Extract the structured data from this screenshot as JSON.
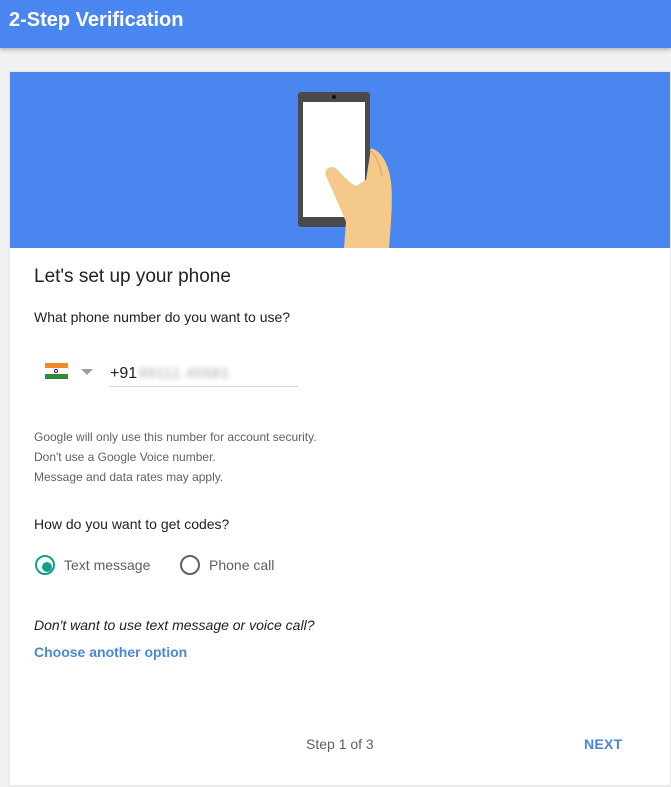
{
  "window": {
    "title": "2-Step Verification"
  },
  "hero": {
    "illustration": "phone-in-hand",
    "background_color": "#4a86f0"
  },
  "setup": {
    "heading": "Let's set up your phone",
    "phone_question": "What phone number do you want to use?",
    "country": {
      "flag_icon": "india-flag-icon",
      "dropdown_icon": "triangle-down-icon"
    },
    "phone": {
      "country_code": "+91",
      "number_masked": "99111 45581"
    },
    "help_lines": [
      "Google will only use this number for account security.",
      "Don't use a Google Voice number.",
      "Message and data rates may apply."
    ],
    "codes_question": "How do you want to get codes?",
    "options": [
      {
        "label": "Text message",
        "selected": true
      },
      {
        "label": "Phone call",
        "selected": false
      }
    ],
    "alternative_question": "Don't want to use text message or voice call?",
    "alternative_link": "Choose another option"
  },
  "footer": {
    "step_text": "Step 1 of 3",
    "next_label": "NEXT"
  },
  "colors": {
    "brand_blue": "#4a86f0",
    "link_blue": "#4a86d8",
    "radio_teal": "#129e8a"
  }
}
